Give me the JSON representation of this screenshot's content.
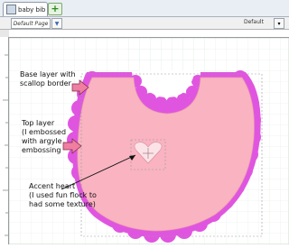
{
  "tabs": [
    {
      "label": "baby bib"
    }
  ],
  "add_tab_symbol": "+",
  "page": {
    "label": "Default Page",
    "right_label": "Default"
  },
  "annotations": {
    "base_layer": [
      "Base layer with",
      "scallop border"
    ],
    "top_layer": [
      "Top layer",
      "(I embossed",
      "with argyle",
      "embossing"
    ],
    "accent_heart": [
      "Accent heart",
      "(I used fun flock to",
      "had some texture)"
    ]
  },
  "icons": {
    "tab_icon": "page-icon",
    "add_tab": "plus-icon",
    "dropdown": "arrow-icon",
    "heart": "heart-icon",
    "crosshair": "crosshair-icon"
  },
  "colors": {
    "base_layer": "#e055e0",
    "top_layer": "#f9b3c1",
    "heart_fill": "#fbe3e7",
    "arrow": "#ef7ea0",
    "grid": "#dfeee3"
  }
}
